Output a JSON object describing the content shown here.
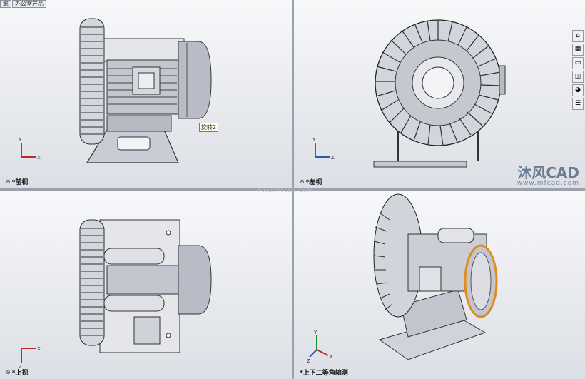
{
  "tabs": [
    "氧",
    "办公室产品"
  ],
  "hud_icons": [
    "zoom-fit-icon",
    "zoom-area-icon",
    "previous-view-icon",
    "section-view-icon",
    "view-orientation-icon",
    "display-style-icon",
    "hide-show-icon",
    "appearance-icon",
    "scene-icon"
  ],
  "window_controls": [
    "tile-icon",
    "restore-icon",
    "minimize-icon",
    "maximize-icon",
    "close-icon"
  ],
  "views": {
    "front": "*前视",
    "left": "*左视",
    "top": "*上视",
    "iso": "*上下二等角轴测"
  },
  "callout": "旋转2",
  "watermark": {
    "brand": "沐风CAD",
    "url": "www.mfcad.com",
    "mid_url": "www.mfcad.com"
  },
  "triad": {
    "x": "X",
    "y": "Y",
    "z": "Z"
  },
  "sidebar_icons": [
    "resources-icon",
    "design-library-icon",
    "file-explorer-icon",
    "view-palette-icon",
    "appearance-palette-icon",
    "custom-properties-icon"
  ],
  "colors": {
    "accent_orange": "#e38b1e",
    "viewport_top": "#f7f8fa",
    "viewport_bottom": "#dcdfe5"
  }
}
